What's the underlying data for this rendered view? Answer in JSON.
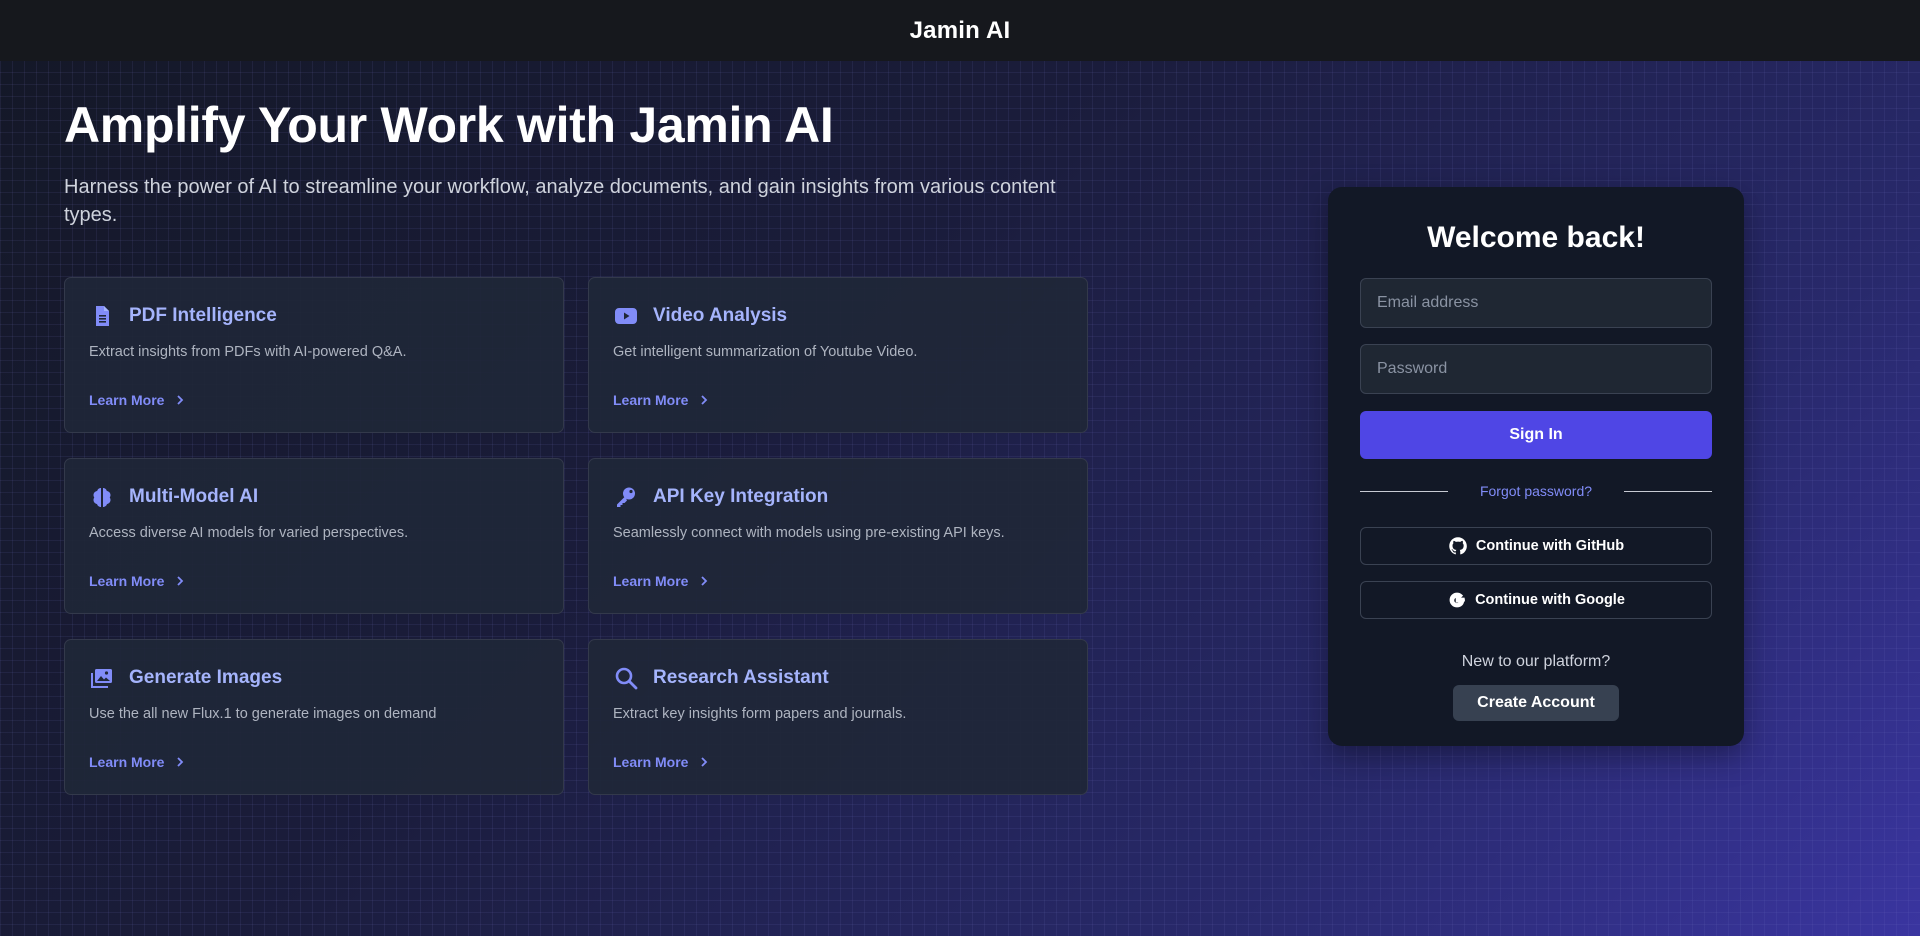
{
  "header": {
    "brand": "Jamin AI"
  },
  "hero": {
    "title": "Amplify Your Work with Jamin AI",
    "subtitle": "Harness the power of AI to streamline your workflow, analyze documents, and gain insights from various content types."
  },
  "features": [
    {
      "icon": "document-icon",
      "title": "PDF Intelligence",
      "description": "Extract insights from PDFs with AI-powered Q&A.",
      "link": "Learn More"
    },
    {
      "icon": "youtube-icon",
      "title": "Video Analysis",
      "description": "Get intelligent summarization of Youtube Video.",
      "link": "Learn More"
    },
    {
      "icon": "brain-icon",
      "title": "Multi-Model AI",
      "description": "Access diverse AI models for varied perspectives.",
      "link": "Learn More"
    },
    {
      "icon": "key-icon",
      "title": "API Key Integration",
      "description": "Seamlessly connect with models using pre-existing API keys.",
      "link": "Learn More"
    },
    {
      "icon": "images-icon",
      "title": "Generate Images",
      "description": "Use the all new Flux.1 to generate images on demand",
      "link": "Learn More"
    },
    {
      "icon": "search-icon",
      "title": "Research Assistant",
      "description": "Extract key insights form papers and journals.",
      "link": "Learn More"
    }
  ],
  "login": {
    "title": "Welcome back!",
    "email_placeholder": "Email address",
    "password_placeholder": "Password",
    "signin_label": "Sign In",
    "forgot_label": "Forgot password?",
    "github_label": "Continue with GitHub",
    "google_label": "Continue with Google",
    "new_prompt": "New to our platform?",
    "create_label": "Create Account"
  },
  "colors": {
    "accent": "#4f46e5",
    "link": "#818cf8",
    "card_title": "#a5b4fc",
    "panel": "#121826"
  }
}
